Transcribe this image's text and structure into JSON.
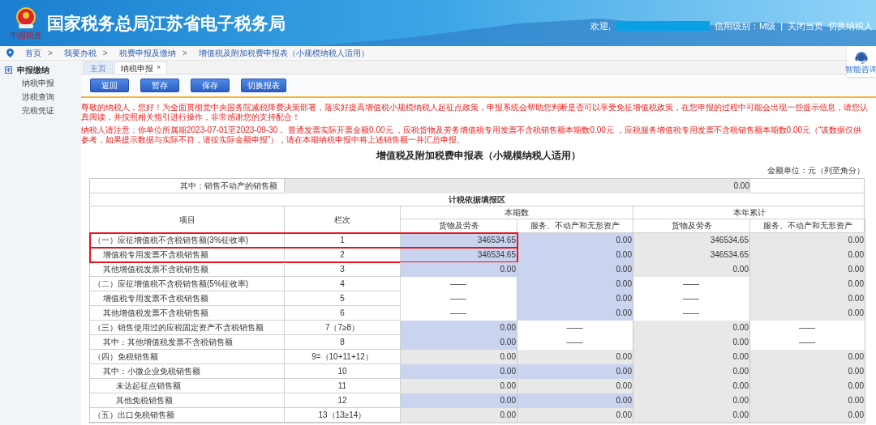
{
  "header": {
    "logo_caption": "中国税务",
    "title": "国家税务总局江苏省电子税务局",
    "welcome": "欢迎,",
    "credit": "信用级别：M级",
    "divider": "|",
    "links": [
      "关闭当页",
      "切换纳税人"
    ]
  },
  "breadcrumb": {
    "separator": ">",
    "items": [
      "首页",
      "我要办税",
      "税费申报及缴纳",
      "增值税及附加税费申报表（小规模纳税人适用）"
    ]
  },
  "assistant": {
    "label": "智能咨询"
  },
  "sidebar": {
    "section": "申报缴纳",
    "items": [
      "纳税申报",
      "涉税查询",
      "完税凭证"
    ]
  },
  "tabs": [
    {
      "label": "主页",
      "selected": false,
      "closable": false
    },
    {
      "label": "纳税申报",
      "selected": true,
      "closable": true,
      "close": "×"
    }
  ],
  "buttons": [
    "返回",
    "暂存",
    "保存",
    "切换报表"
  ],
  "notices": [
    "尊敬的纳税人，您好！为全面贯彻党中央国务院减税降费决策部署，落实好提高增值税小规模纳税人起征点政策，申报系统会帮助您判断是否可以享受免征增值税政策，在您申报的过程中可能会出现一些提示信息，请您认真阅读，并按照相关指引进行操作，非常感谢您的支持配合！",
    "纳税人请注意：你单位所属期2023-07-01至2023-09-30， 普通发票实际开票金额0.00元 ，应税货物及劳务增值税专用发票不含税销售额本期数0.00元 ，应税服务增值税专用发票不含税销售额本期数0.00元（“该数据仅供参考，如果提示数据与实际不符，请按实际金额申报”），请在本期纳税申报中将上述销售额一并汇总申报。"
  ],
  "form": {
    "title": "增值税及附加税费申报表（小规模纳税人适用）",
    "unit": "金额单位：元（列至角分）",
    "top_row": {
      "label": "其中：销售不动产的销售额",
      "value": "0.00"
    },
    "section": "计税依据填报区",
    "columns": {
      "item": "项目",
      "line": "栏次",
      "period": "本期数",
      "year": "本年累计",
      "sub": [
        "货物及劳务",
        "服务、不动产和无形资产",
        "货物及劳务",
        "服务、不动产和无形资产"
      ]
    },
    "rows": [
      {
        "label": "（一）应征增值税不含税销售额(3%征收率)",
        "line": "1",
        "highlighted": true,
        "cells": [
          {
            "kind": "input",
            "text": "346534.65"
          },
          {
            "kind": "input",
            "text": "0.00"
          },
          {
            "kind": "readonly",
            "text": "346534.65"
          },
          {
            "kind": "readonly",
            "text": "0.00"
          }
        ],
        "children": [
          {
            "label": "增值税专用发票不含税销售额",
            "line": "2",
            "highlighted": true,
            "cells": [
              {
                "kind": "input",
                "text": "346534.65"
              },
              {
                "kind": "input",
                "text": "0.00"
              },
              {
                "kind": "readonly",
                "text": "346534.65"
              },
              {
                "kind": "readonly",
                "text": "0.00"
              }
            ]
          },
          {
            "label": "其他增值税发票不含税销售额",
            "line": "3",
            "highlighted": false,
            "cells": [
              {
                "kind": "input",
                "text": "0.00"
              },
              {
                "kind": "input",
                "text": "0.00"
              },
              {
                "kind": "readonly",
                "text": "0.00"
              },
              {
                "kind": "readonly",
                "text": "0.00"
              }
            ]
          }
        ]
      },
      {
        "label": "（二）应征增值税不含税销售额(5%征收率)",
        "line": "4",
        "highlighted": false,
        "cells": [
          {
            "kind": "blank",
            "text": "——"
          },
          {
            "kind": "input",
            "text": "0.00"
          },
          {
            "kind": "blank",
            "text": "——"
          },
          {
            "kind": "readonly",
            "text": "0.00"
          }
        ],
        "children": [
          {
            "label": "增值税专用发票不含税销售额",
            "line": "5",
            "highlighted": false,
            "cells": [
              {
                "kind": "blank",
                "text": "——"
              },
              {
                "kind": "input",
                "text": "0.00"
              },
              {
                "kind": "blank",
                "text": "——"
              },
              {
                "kind": "readonly",
                "text": "0.00"
              }
            ]
          },
          {
            "label": "其他增值税发票不含税销售额",
            "line": "6",
            "highlighted": false,
            "cells": [
              {
                "kind": "blank",
                "text": "——"
              },
              {
                "kind": "input",
                "text": "0.00"
              },
              {
                "kind": "blank",
                "text": "——"
              },
              {
                "kind": "readonly",
                "text": "0.00"
              }
            ]
          }
        ]
      },
      {
        "label": "（三）销售使用过的应税固定资产不含税销售额",
        "line": "7（7≥8）",
        "highlighted": false,
        "cells": [
          {
            "kind": "input",
            "text": "0.00"
          },
          {
            "kind": "blank",
            "text": "——"
          },
          {
            "kind": "readonly",
            "text": "0.00"
          },
          {
            "kind": "blank",
            "text": "——"
          }
        ],
        "children": [
          {
            "label": "其中：其他增值税发票不含税销售额",
            "line": "8",
            "highlighted": false,
            "cells": [
              {
                "kind": "input",
                "text": "0.00"
              },
              {
                "kind": "blank",
                "text": "——"
              },
              {
                "kind": "readonly",
                "text": "0.00"
              },
              {
                "kind": "blank",
                "text": "——"
              }
            ]
          }
        ]
      },
      {
        "label": "（四）免税销售额",
        "line": "9=（10+11+12）",
        "highlighted": false,
        "cells": [
          {
            "kind": "readonly",
            "text": "0.00"
          },
          {
            "kind": "readonly",
            "text": "0.00"
          },
          {
            "kind": "readonly",
            "text": "0.00"
          },
          {
            "kind": "readonly",
            "text": "0.00"
          }
        ],
        "children": [
          {
            "label": "其中：小微企业免税销售额",
            "line": "10",
            "highlighted": false,
            "cells": [
              {
                "kind": "input",
                "text": "0.00"
              },
              {
                "kind": "input",
                "text": "0.00"
              },
              {
                "kind": "readonly",
                "text": "0.00"
              },
              {
                "kind": "readonly",
                "text": "0.00"
              }
            ],
            "children": [
              {
                "label": "未达起征点销售额",
                "line": "11",
                "highlighted": false,
                "cells": [
                  {
                    "kind": "readonly",
                    "text": "0.00"
                  },
                  {
                    "kind": "readonly",
                    "text": "0.00"
                  },
                  {
                    "kind": "readonly",
                    "text": "0.00"
                  },
                  {
                    "kind": "readonly",
                    "text": "0.00"
                  }
                ]
              },
              {
                "label": "其他免税销售额",
                "line": "12",
                "highlighted": false,
                "cells": [
                  {
                    "kind": "input",
                    "text": "0.00"
                  },
                  {
                    "kind": "input",
                    "text": "0.00"
                  },
                  {
                    "kind": "readonly",
                    "text": "0.00"
                  },
                  {
                    "kind": "readonly",
                    "text": "0.00"
                  }
                ]
              }
            ]
          }
        ]
      },
      {
        "label": "（五）出口免税销售额",
        "line": "13（13≥14）",
        "highlighted": false,
        "cells": [
          {
            "kind": "readonly",
            "text": "0.00"
          },
          {
            "kind": "readonly",
            "text": "0.00"
          },
          {
            "kind": "readonly",
            "text": "0.00"
          },
          {
            "kind": "readonly",
            "text": "0.00"
          }
        ]
      }
    ]
  }
}
